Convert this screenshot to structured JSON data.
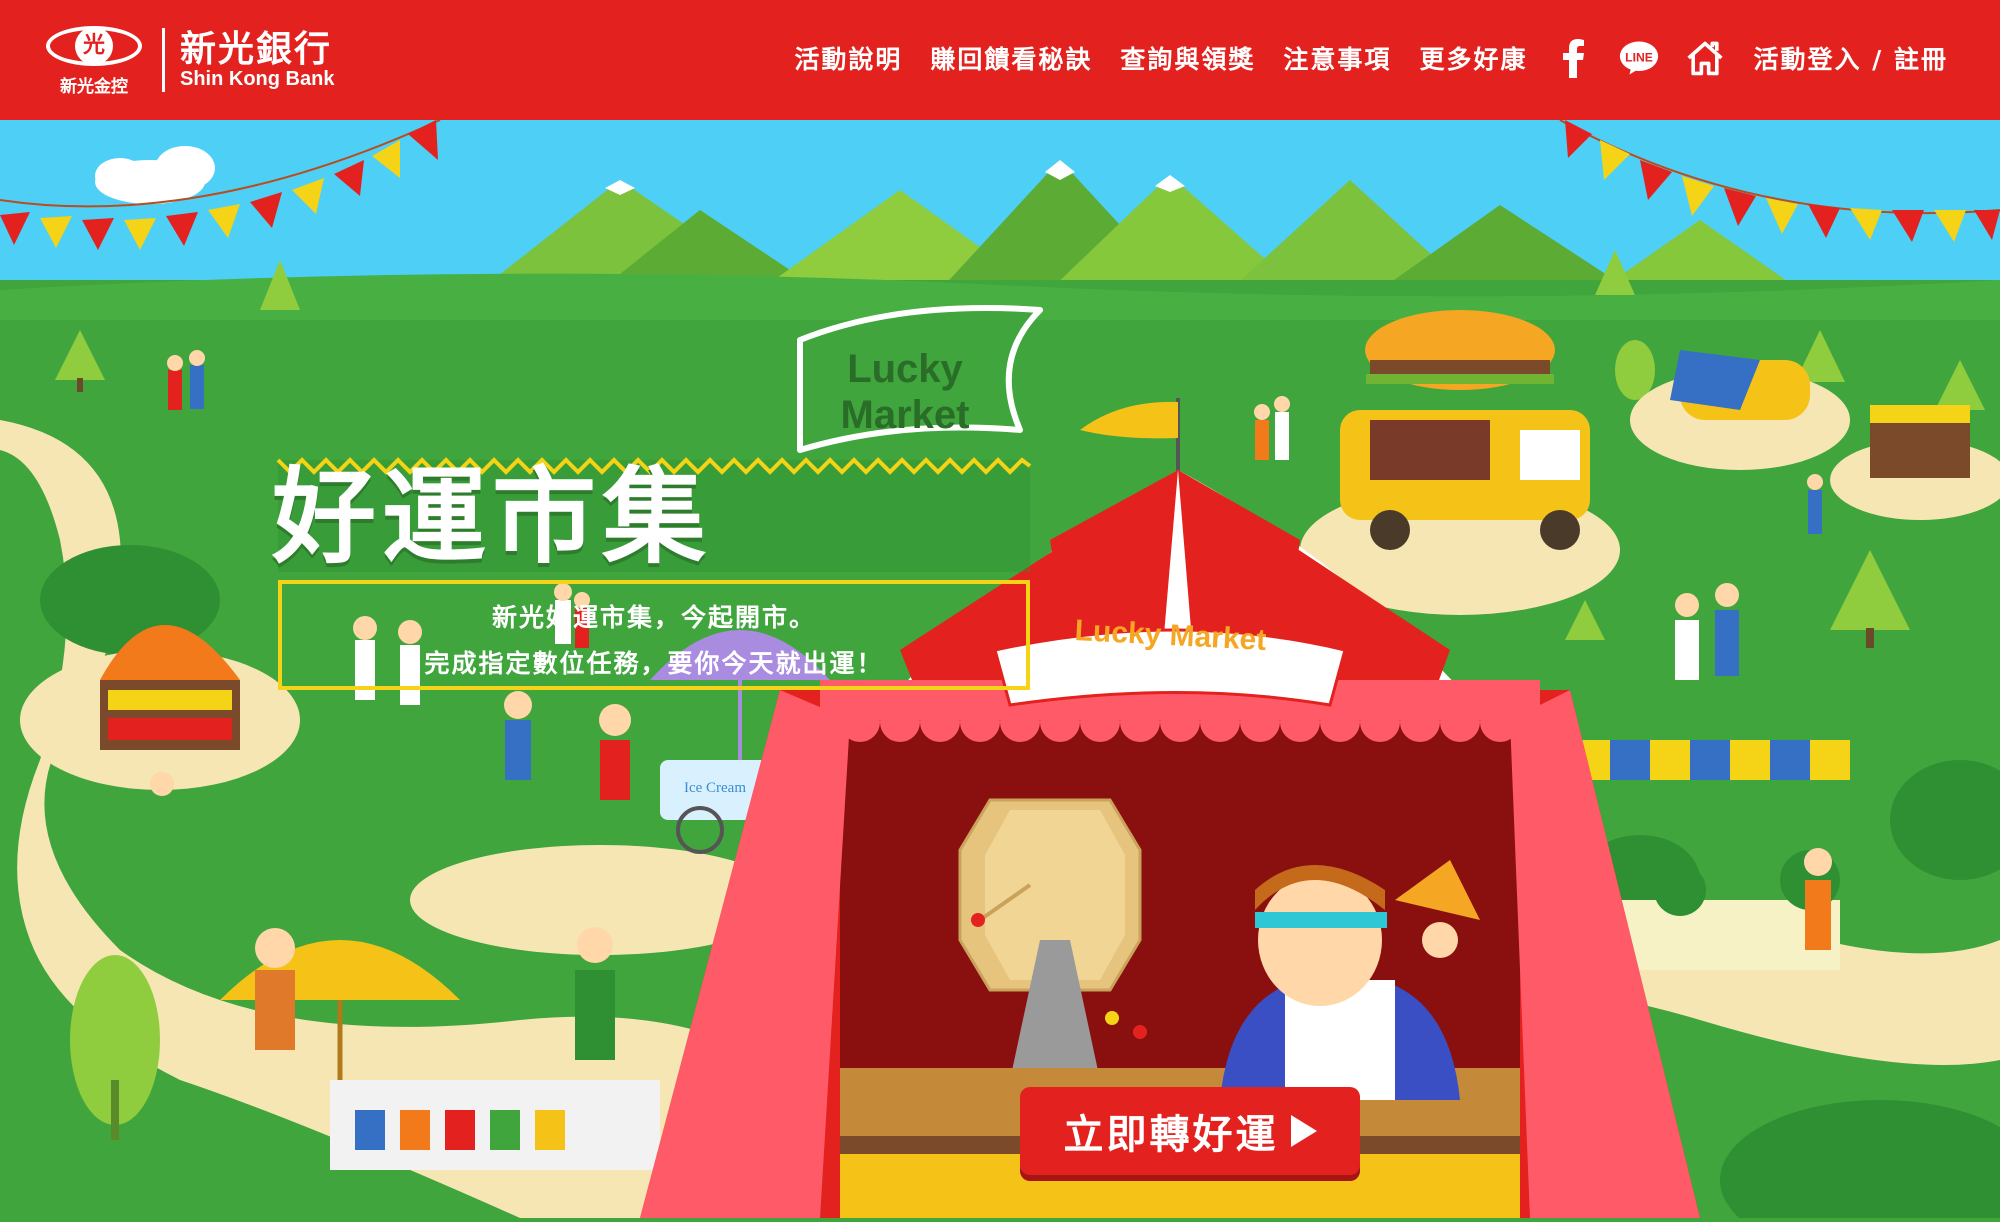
{
  "brand": {
    "emblem": "光",
    "group_name": "新光金控",
    "bank_name": "新光銀行",
    "bank_name_en": "Shin Kong Bank"
  },
  "nav": {
    "items": [
      "活動說明",
      "賺回饋看秘訣",
      "查詢與領獎",
      "注意事項",
      "更多好康"
    ],
    "icons": [
      "facebook-icon",
      "line-icon",
      "home-icon"
    ],
    "line_label": "LINE",
    "login": "活動登入 / 註冊"
  },
  "hero": {
    "title": "好運市集",
    "flag_line1": "Lucky",
    "flag_line2": "Market",
    "subtitle_line1": "新光好運市集，今起開市。",
    "subtitle_line2": "完成指定數位任務，要你今天就出運！",
    "tent_sign": "Lucky Market",
    "ice_cream_sign": "Ice Cream",
    "cta_label": "立即轉好運"
  },
  "colors": {
    "brand_red": "#e3221f",
    "sky": "#4dcff6",
    "grass": "#3fa53c",
    "accent_yellow": "#f5d316"
  }
}
